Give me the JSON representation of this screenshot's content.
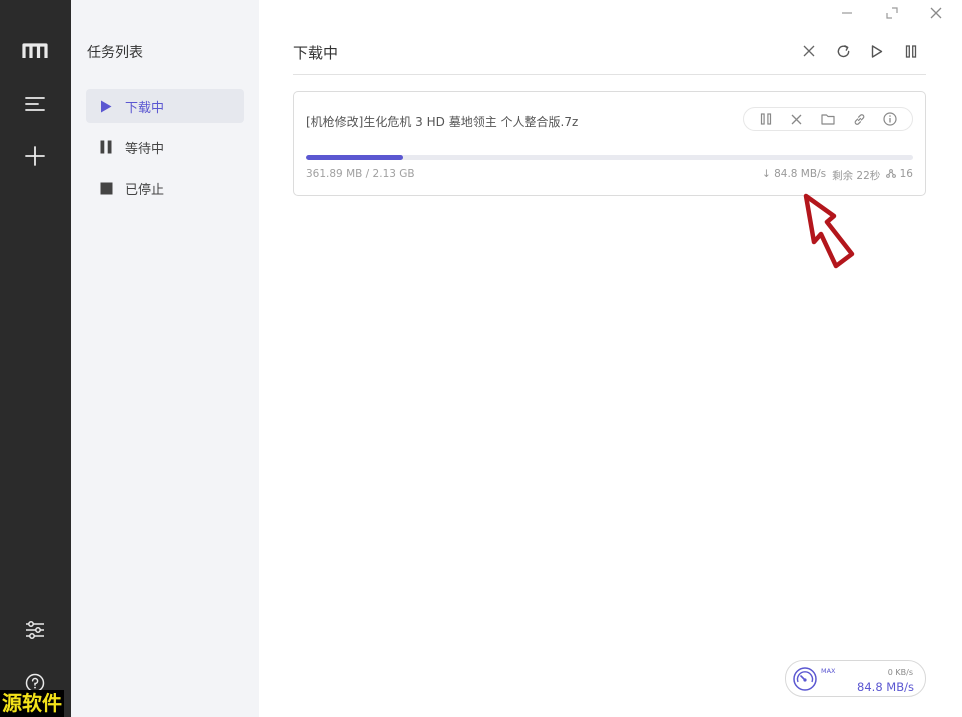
{
  "rail": {
    "icons": [
      "logo-icon",
      "menu-icon",
      "plus-icon",
      "settings-sliders-icon",
      "help-icon"
    ]
  },
  "watermark": "源软件",
  "sidebar": {
    "title": "任务列表",
    "items": [
      {
        "label": "下载中",
        "icon": "play-icon",
        "active": true
      },
      {
        "label": "等待中",
        "icon": "pause-icon",
        "active": false
      },
      {
        "label": "已停止",
        "icon": "stop-icon",
        "active": false
      }
    ]
  },
  "main": {
    "title": "下载中",
    "toolbar_icons": [
      "close-icon",
      "refresh-icon",
      "play-icon",
      "pause-icon"
    ]
  },
  "task": {
    "name": "[机枪修改]生化危机 3 HD 墓地领主 个人整合版.7z",
    "size": "361.89 MB / 2.13 GB",
    "progress": 0.16,
    "speed": "↓ 84.8 MB/s",
    "remaining": "剩余 22秒",
    "connections": "16",
    "action_icons": [
      "pause-icon",
      "delete-icon",
      "folder-icon",
      "link-icon",
      "info-icon"
    ]
  },
  "speedometer": {
    "max_label": "MAX",
    "upload": "0 KB/s",
    "download": "84.8 MB/s"
  },
  "colors": {
    "accent": "#5b57d1",
    "rail": "#2b2b2b",
    "sidebar": "#f3f4f7",
    "annotation": "#b3161c"
  }
}
